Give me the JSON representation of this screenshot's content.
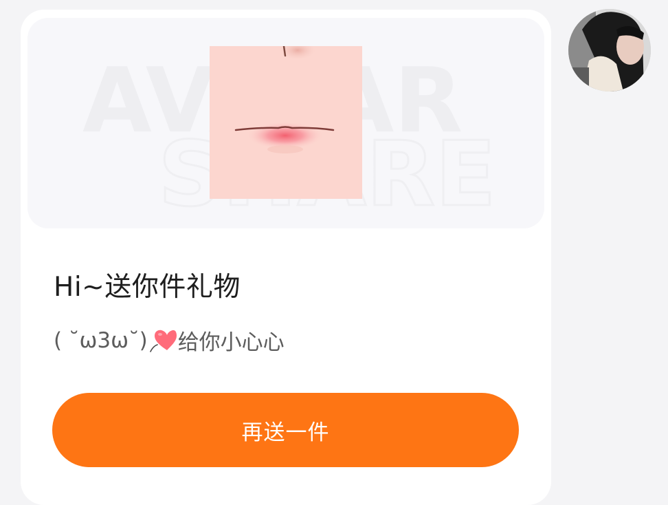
{
  "message_card": {
    "watermark": {
      "line1": "AVATAR",
      "line2": "SHARE"
    },
    "gift_image": "virtual-gift-lips",
    "title": "Hi~送你件礼物",
    "subtitle_prefix": "( ˘ω3ω˘)",
    "subtitle_heart_icon": "heart-icon",
    "subtitle_text": "给你小心心",
    "send_again_button": "再送一件"
  },
  "sender": {
    "avatar": "user-avatar"
  },
  "colors": {
    "accent": "#fe7514",
    "page_background": "#f4f4f6",
    "card_background": "#ffffff",
    "gift_area_background": "#f7f7fa",
    "heart": "#ff6b7a"
  }
}
